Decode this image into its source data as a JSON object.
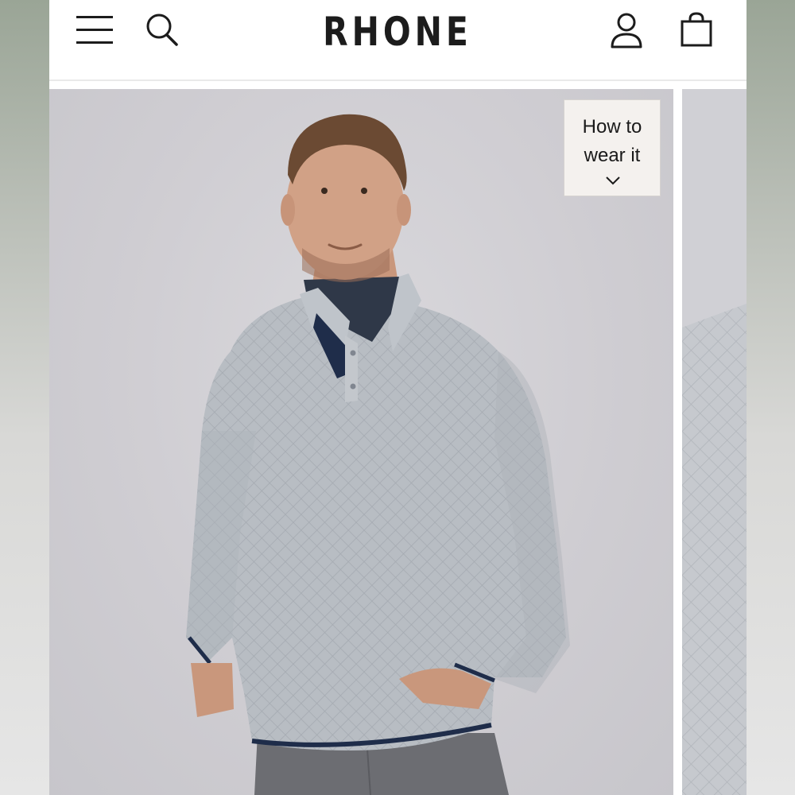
{
  "header": {
    "brand": "RHONE",
    "icons": {
      "menu": "hamburger-menu-icon",
      "search": "search-icon",
      "account": "user-icon",
      "bag": "shopping-bag-icon"
    }
  },
  "gallery": {
    "overlay_button": {
      "line1": "How to",
      "line2": "wear it",
      "icon": "chevron-down-icon"
    },
    "main_image": "model wearing quilted grey quarter-snap pullover",
    "next_image": "close-up of quilted grey fabric texture"
  },
  "colors": {
    "text": "#1c1c1c",
    "sweater": "#b7bcc2",
    "trim": "#1f2d4a",
    "backdrop": "#cfcdd2"
  }
}
